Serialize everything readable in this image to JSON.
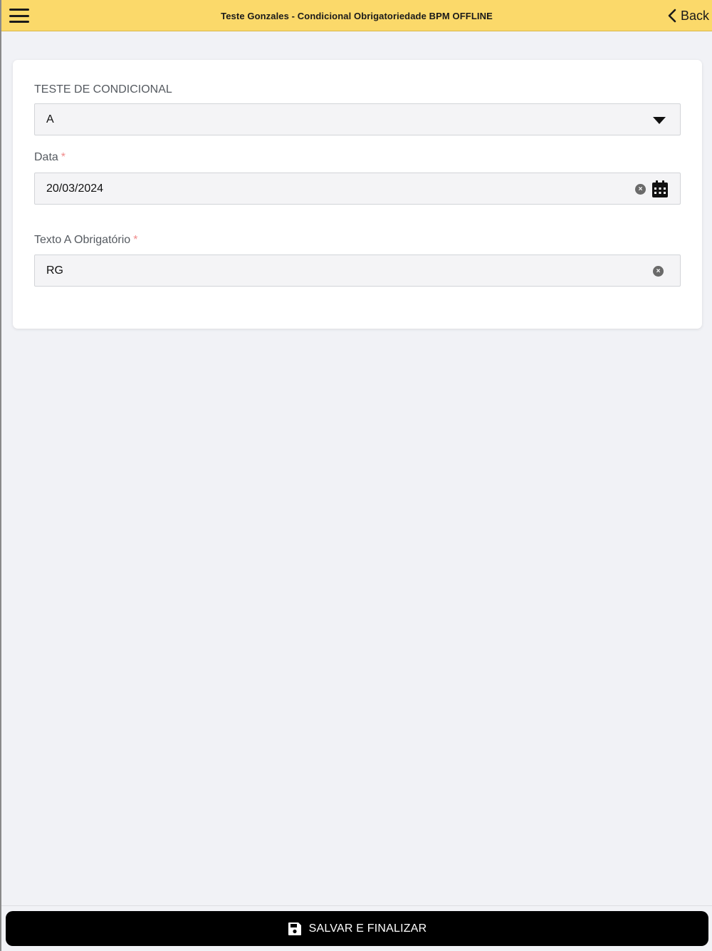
{
  "header": {
    "title": "Teste Gonzales - Condicional Obrigatoriedade BPM OFFLINE",
    "back_label": "Back",
    "background_color": "#fbd96a"
  },
  "form": {
    "condicional": {
      "label": "TESTE DE CONDICIONAL",
      "value": "A"
    },
    "data": {
      "label": "Data",
      "required_mark": "*",
      "value": "20/03/2024"
    },
    "texto": {
      "label": "Texto A Obrigatório",
      "required_mark": "*",
      "value": "RG"
    }
  },
  "footer": {
    "save_label": "SALVAR E FINALIZAR",
    "button_color": "#000000"
  },
  "icons": {
    "menu": "hamburger-menu-icon",
    "back": "chevron-left-icon",
    "dropdown": "caret-down-icon",
    "clear": "clear-circle-x-icon",
    "calendar": "calendar-icon",
    "save": "floppy-disk-icon"
  }
}
